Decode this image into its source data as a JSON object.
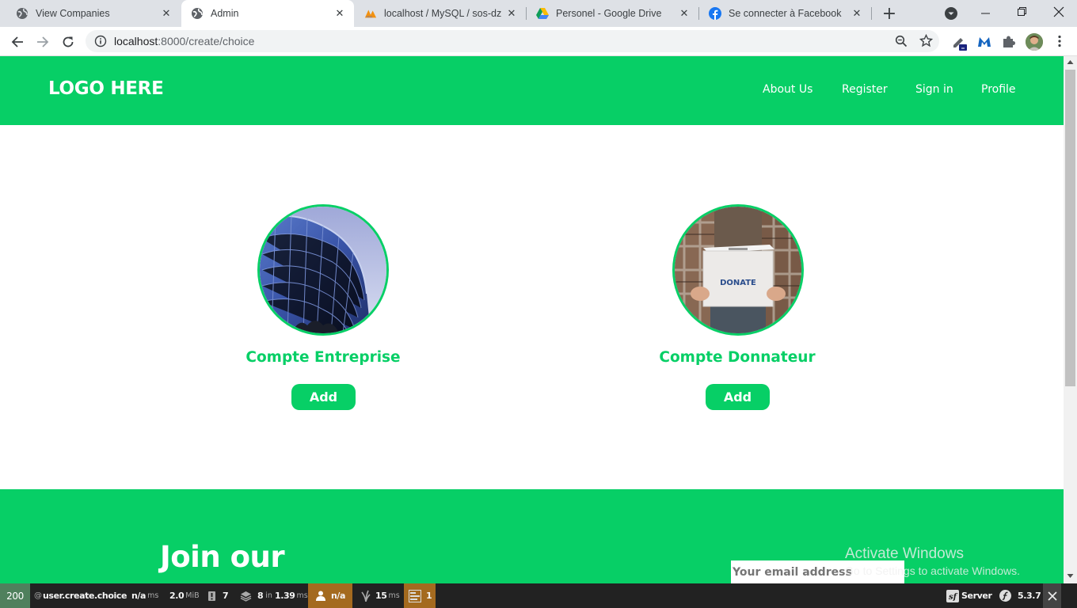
{
  "browser": {
    "tabs": [
      {
        "title": "View Companies",
        "active": false
      },
      {
        "title": "Admin",
        "active": true
      },
      {
        "title": "localhost / MySQL / sos-dz /",
        "active": false
      },
      {
        "title": "Personel - Google Drive",
        "active": false
      },
      {
        "title": "Se connecter à Facebook",
        "active": false
      }
    ],
    "url_host": "localhost",
    "url_rest": ":8000/create/choice"
  },
  "navbar": {
    "logo": "LOGO HERE",
    "links": [
      "About Us",
      "Register",
      "Sign in",
      "Profile"
    ]
  },
  "cards": [
    {
      "title": "Compte Entreprise",
      "button": "Add"
    },
    {
      "title": "Compte Donnateur",
      "button": "Add",
      "image_text": "DONATE"
    }
  ],
  "footer": {
    "heading": "Join our",
    "email_placeholder": "Your email address"
  },
  "windows_notice": {
    "line1": "Activate Windows",
    "line2": "Go to Settings to activate Windows."
  },
  "symfony_toolbar": {
    "status": "200",
    "route_prefix": "@",
    "route": "user.create.choice",
    "time": "n/a",
    "time_unit": "ms",
    "memory": "2.0",
    "memory_unit": "MiB",
    "logs": "7",
    "cache": "8",
    "cache_in": "in",
    "cache_time": "1.39",
    "cache_unit": "ms",
    "user": "n/a",
    "twig_time": "15",
    "twig_unit": "ms",
    "forms": "1",
    "server": "Server",
    "version": "5.3.7",
    "status_color": "#4f805d",
    "user_bg": "#a46a1f"
  }
}
